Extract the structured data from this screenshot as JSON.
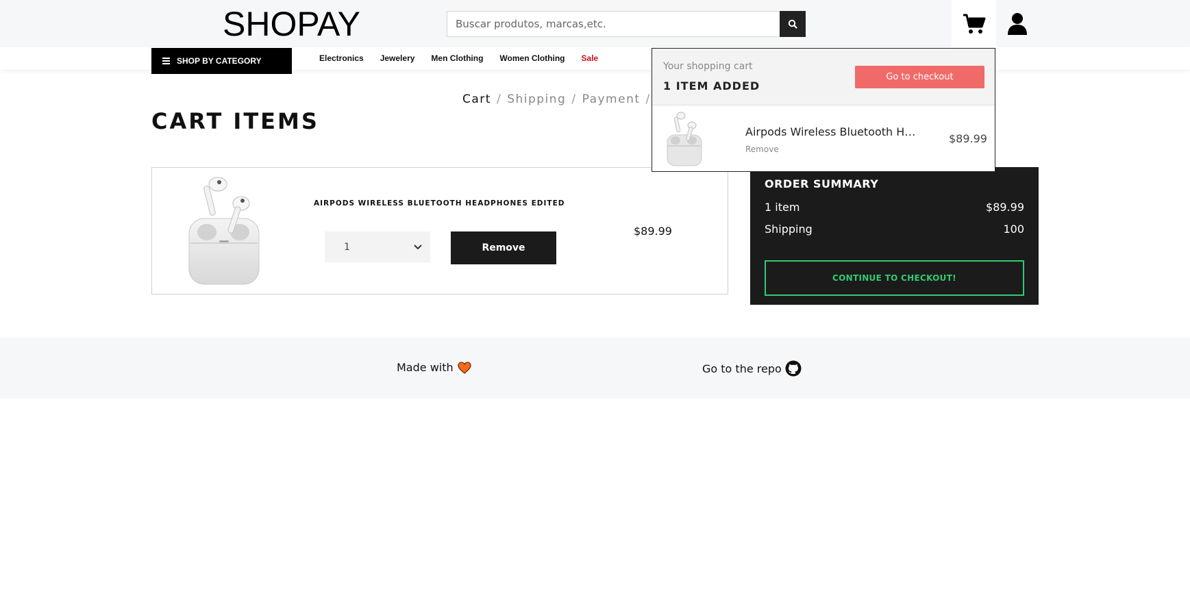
{
  "header": {
    "logo": "SHOPAY",
    "search_placeholder": "Buscar produtos, marcas,etc."
  },
  "nav": {
    "category_button": "SHOP BY CATEGORY",
    "links": [
      "Electronics",
      "Jewelery",
      "Men Clothing",
      "Women Clothing",
      "Sale"
    ]
  },
  "breadcrumb": [
    "Cart",
    "Shipping",
    "Payment"
  ],
  "page_title": "CART ITEMS",
  "cart_item": {
    "name": "AIRPODS WIRELESS BLUETOOTH HEADPHONES EDITED",
    "quantity": "1",
    "remove_label": "Remove",
    "price": "$89.99"
  },
  "summary": {
    "title": "ORDER SUMMARY",
    "items_label": "1 item",
    "items_value": "$89.99",
    "shipping_label": "Shipping",
    "shipping_value": "100",
    "checkout_label": "CONTINUE TO CHECKOUT!"
  },
  "footer": {
    "made_with": "Made with",
    "repo": "Go to the repo"
  },
  "dropdown": {
    "subtitle": "Your shopping cart",
    "count": "1 ITEM ADDED",
    "checkout_label": "Go to checkout",
    "item_name": "Airpods Wireless Bluetooth Headphones Edited",
    "item_remove": "Remove",
    "item_price": "$89.99"
  },
  "colors": {
    "accent_checkout": "#f16a6a",
    "continue_green": "#2ecc71",
    "sale_red": "#d0111b",
    "heart": "#f26c1d"
  }
}
